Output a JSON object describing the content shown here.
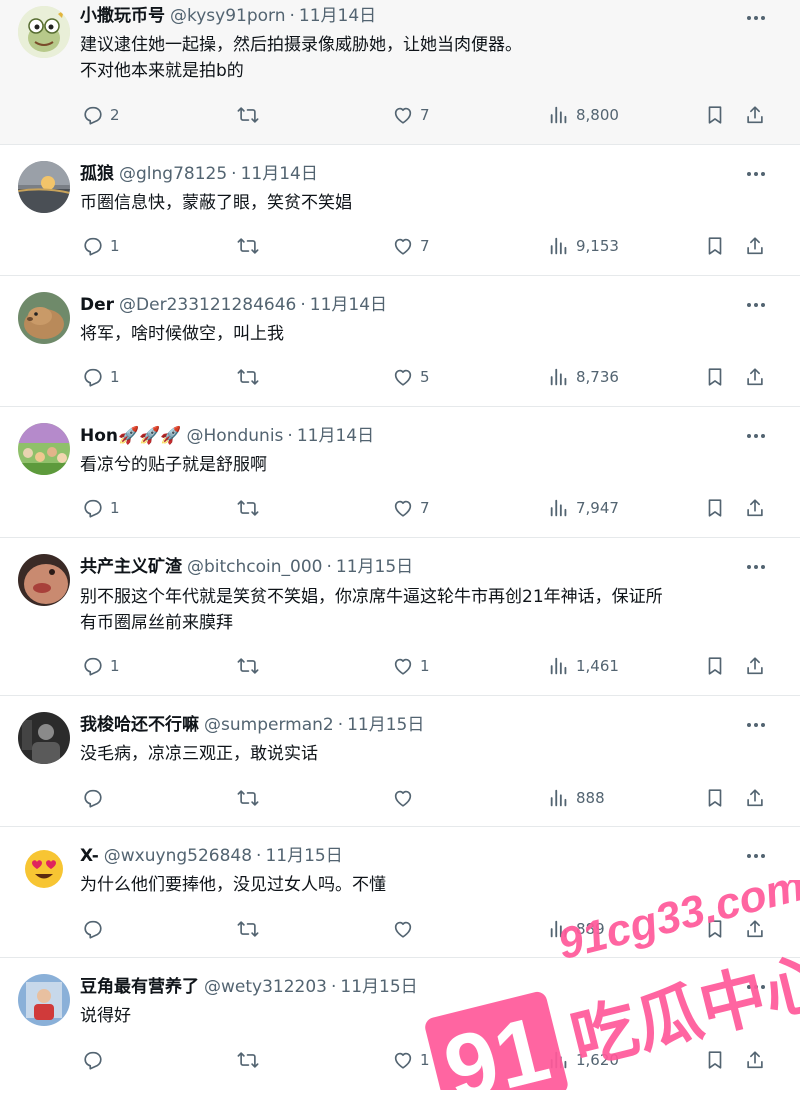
{
  "tweets": [
    {
      "name": "小撒玩币号",
      "handle": "@kysy91porn",
      "date": "11月14日",
      "lines": [
        "建议逮住她一起操，然后拍摄录像威胁她，让她当肉便器。",
        "不对他本来就是拍b的"
      ],
      "replies": "2",
      "retweets": "",
      "likes": "7",
      "views": "8,800",
      "avatar_icon": "frog-cartoon-avatar"
    },
    {
      "name": "孤狼",
      "handle": "@glng78125",
      "date": "11月14日",
      "lines": [
        "币圈信息快，蒙蔽了眼，笑贫不笑娼"
      ],
      "replies": "1",
      "retweets": "",
      "likes": "7",
      "views": "9,153",
      "avatar_icon": "sunset-avatar"
    },
    {
      "name": "Der",
      "handle": "@Der233121284646",
      "date": "11月14日",
      "lines": [
        "将军，啥时候做空，叫上我"
      ],
      "replies": "1",
      "retweets": "",
      "likes": "5",
      "views": "8,736",
      "avatar_icon": "capybara-avatar"
    },
    {
      "name": "Hon🚀🚀🚀",
      "handle": "@Hondunis",
      "date": "11月14日",
      "lines": [
        "看凉兮的贴子就是舒服啊"
      ],
      "replies": "1",
      "retweets": "",
      "likes": "7",
      "views": "7,947",
      "avatar_icon": "crowd-avatar"
    },
    {
      "name": "共产主义矿渣",
      "handle": "@bitchcoin_000",
      "date": "11月15日",
      "lines": [
        "别不服这个年代就是笑贫不笑娼，你凉席牛逼这轮牛市再创21年神话，保证所",
        "有币圈屌丝前来膜拜"
      ],
      "replies": "1",
      "retweets": "",
      "likes": "1",
      "views": "1,461",
      "avatar_icon": "face-closeup-avatar"
    },
    {
      "name": "我梭哈还不行嘛",
      "handle": "@sumperman2",
      "date": "11月15日",
      "lines": [
        "没毛病，凉凉三观正，敢说实话"
      ],
      "replies": "",
      "retweets": "",
      "likes": "",
      "views": "888",
      "avatar_icon": "dark-photo-avatar"
    },
    {
      "name": "X-",
      "handle": "@wxuyng526848",
      "date": "11月15日",
      "lines": [
        "为什么他们要捧他，没见过女人吗。不懂"
      ],
      "replies": "",
      "retweets": "",
      "likes": "",
      "views": "889",
      "avatar_icon": "heart-eyes-emoji-avatar"
    },
    {
      "name": "豆角最有营养了",
      "handle": "@wety312203",
      "date": "11月15日",
      "lines": [
        "说得好"
      ],
      "replies": "",
      "retweets": "",
      "likes": "1",
      "views": "1,620",
      "avatar_icon": "person-photo-avatar"
    }
  ],
  "watermark": {
    "url": "91cg33.com",
    "badge": "91",
    "name": "吃瓜中心",
    "color": "#ff5a9a"
  },
  "colors": {
    "text": "#0f1419",
    "muted": "#536471",
    "divider": "#e6e9eb"
  }
}
